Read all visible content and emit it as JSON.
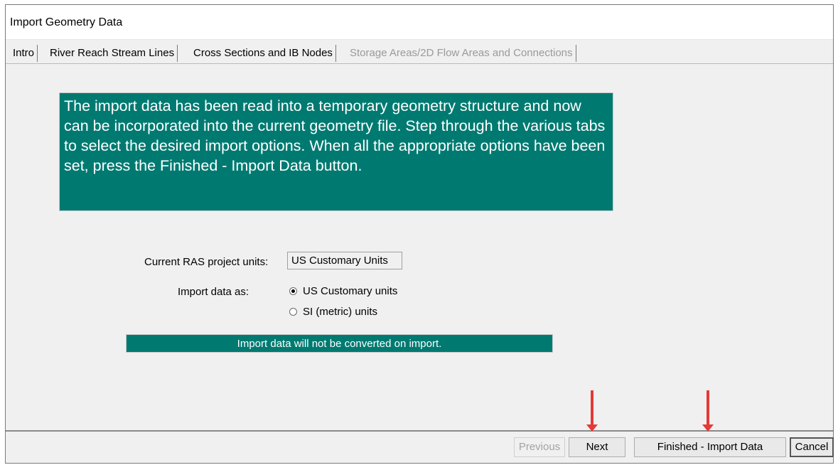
{
  "window": {
    "title": "Import Geometry Data"
  },
  "tabs": [
    {
      "label": "Intro",
      "state": "active"
    },
    {
      "label": "River Reach Stream Lines",
      "state": "enabled"
    },
    {
      "label": "Cross Sections and IB Nodes",
      "state": "enabled"
    },
    {
      "label": "Storage Areas/2D Flow Areas and Connections",
      "state": "disabled"
    }
  ],
  "intro": {
    "info_text": "The import data has been read into a temporary geometry structure and now can be incorporated into the current geometry file.  Step through the various tabs to select the desired import options.  When all the appropriate options have been set, press the Finished - Import Data button.",
    "units_label": "Current RAS project units:",
    "units_value": "US Customary Units",
    "import_label": "Import data as:",
    "options": [
      {
        "label": "US Customary units",
        "selected": true
      },
      {
        "label": "SI (metric) units",
        "selected": false
      }
    ],
    "status_text": "Import data will not be converted on import."
  },
  "footer": {
    "previous_label": "Previous",
    "next_label": "Next",
    "finish_label": "Finished - Import Data",
    "cancel_label": "Cancel"
  },
  "colors": {
    "panel_teal": "#007a71",
    "annotation_arrow": "#e53a36"
  }
}
